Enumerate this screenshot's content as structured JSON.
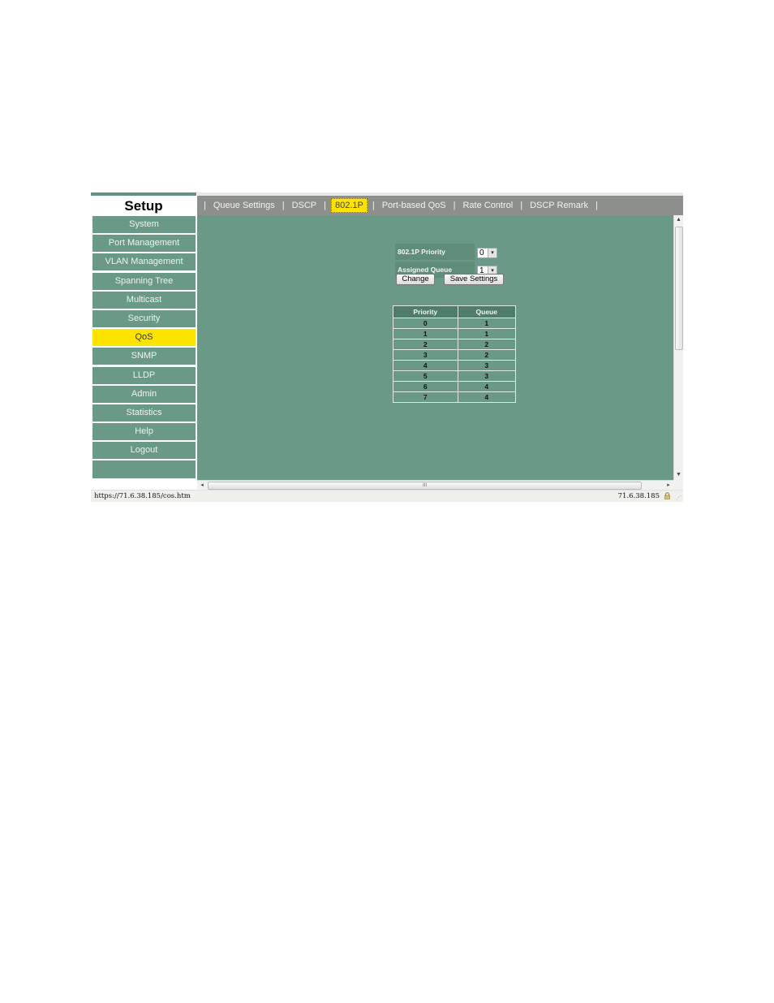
{
  "nav": {
    "title": "Setup",
    "items": [
      {
        "label": "System",
        "active": false
      },
      {
        "label": "Port Management",
        "active": false
      },
      {
        "label": "VLAN Management",
        "active": false
      },
      {
        "label": "Spanning Tree",
        "active": false
      },
      {
        "label": "Multicast",
        "active": false
      },
      {
        "label": "Security",
        "active": false
      },
      {
        "label": "QoS",
        "active": true
      },
      {
        "label": "SNMP",
        "active": false
      },
      {
        "label": "LLDP",
        "active": false
      },
      {
        "label": "Admin",
        "active": false
      },
      {
        "label": "Statistics",
        "active": false
      },
      {
        "label": "Help",
        "active": false
      },
      {
        "label": "Logout",
        "active": false
      }
    ]
  },
  "tabs": {
    "separator": "|",
    "items": [
      {
        "label": "Queue Settings",
        "active": false
      },
      {
        "label": "DSCP",
        "active": false
      },
      {
        "label": "802.1P",
        "active": true
      },
      {
        "label": "Port-based QoS",
        "active": false
      },
      {
        "label": "Rate Control",
        "active": false
      },
      {
        "label": "DSCP Remark",
        "active": false
      }
    ]
  },
  "form": {
    "priority_label": "802.1P Priority",
    "priority_value": "0",
    "queue_label": "Assigned Queue",
    "queue_value": "1",
    "change_label": "Change",
    "save_label": "Save Settings"
  },
  "mapping": {
    "headers": [
      "Priority",
      "Queue"
    ],
    "rows": [
      [
        "0",
        "1"
      ],
      [
        "1",
        "1"
      ],
      [
        "2",
        "2"
      ],
      [
        "3",
        "2"
      ],
      [
        "4",
        "3"
      ],
      [
        "5",
        "3"
      ],
      [
        "6",
        "4"
      ],
      [
        "7",
        "4"
      ]
    ]
  },
  "icons": {
    "dropdown": "▾",
    "scroll_up": "▲",
    "scroll_down": "▼",
    "scroll_left": "◂",
    "scroll_right": "▸",
    "grip": "III",
    "resize": "⋰"
  },
  "statusbar": {
    "url": "https://71.6.38.185/cos.htm",
    "host": "71.6.38.185"
  },
  "colors": {
    "pane": "#6a9a87",
    "accent": "#fce300",
    "tabbar": "#8c8f8b"
  }
}
